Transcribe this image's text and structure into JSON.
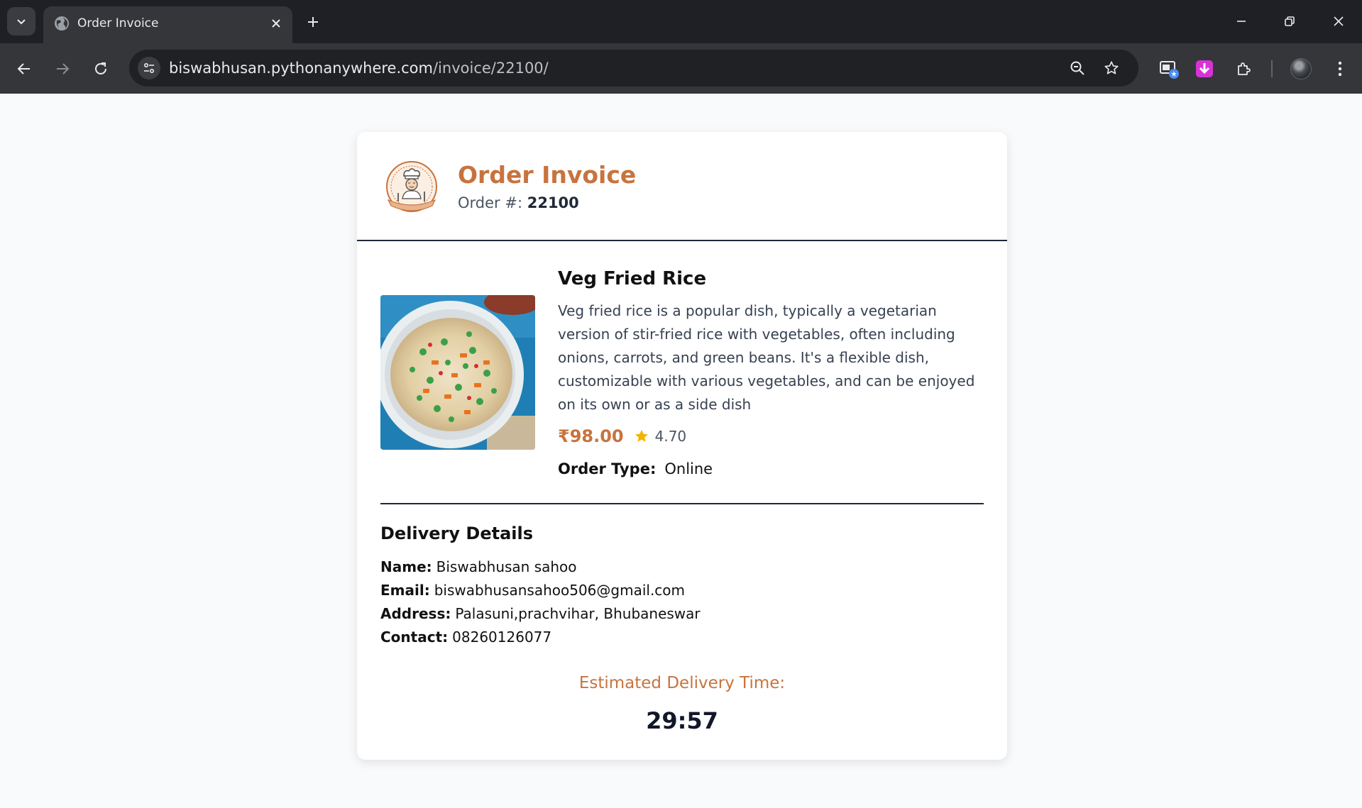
{
  "browser": {
    "tab_title": "Order Invoice",
    "url_host": "biswabhusan.pythonanywhere.com",
    "url_path": "/invoice/22100/"
  },
  "invoice": {
    "title": "Order Invoice",
    "order_label": "Order #:",
    "order_number": "22100",
    "logo_icon": "chef-logo-icon"
  },
  "item": {
    "name": "Veg Fried Rice",
    "description": "Veg fried rice is a popular dish, typically a vegetarian version of stir-fried rice with vegetables, often including onions, carrots, and green beans. It's a flexible dish, customizable with various vegetables, and can be enjoyed on its own or as a side dish",
    "price": "₹98.00",
    "rating": "4.70",
    "order_type_label": "Order Type:",
    "order_type": "Online"
  },
  "delivery": {
    "title": "Delivery Details",
    "name_label": "Name:",
    "name": "Biswabhusan sahoo",
    "email_label": "Email:",
    "email": "biswabhusansahoo506@gmail.com",
    "address_label": "Address:",
    "address": "Palasuni,prachvihar, Bhubaneswar",
    "contact_label": "Contact:",
    "contact": "08260126077"
  },
  "eta": {
    "label": "Estimated Delivery Time:",
    "time": "29:57"
  },
  "colors": {
    "accent": "#c8733e",
    "star": "#f5b301"
  }
}
